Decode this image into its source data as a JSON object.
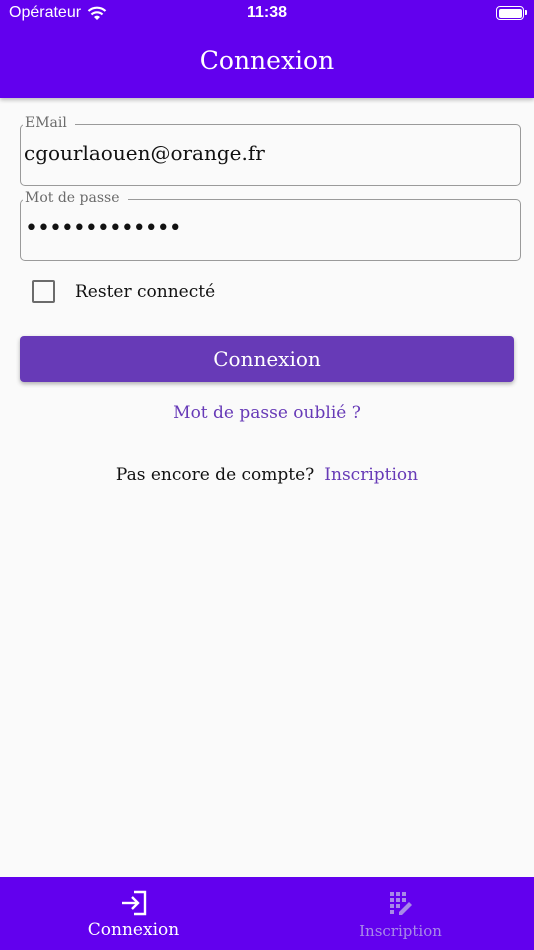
{
  "status_bar": {
    "carrier": "Opérateur",
    "time": "11:38"
  },
  "app_bar": {
    "title": "Connexion"
  },
  "form": {
    "email": {
      "label": "EMail",
      "value": "cgourlaouen@orange.fr"
    },
    "password": {
      "label": "Mot de passe",
      "value_masked": "•••••••••••••"
    },
    "remember": {
      "label": "Rester connecté",
      "checked": false
    },
    "submit_label": "Connexion",
    "forgot_label": "Mot de passe oublié ?",
    "signup_prompt": "Pas encore de compte?",
    "signup_link": "Inscription"
  },
  "bottom_nav": {
    "items": [
      {
        "label": "Connexion",
        "icon": "login-icon",
        "active": true
      },
      {
        "label": "Inscription",
        "icon": "register-icon",
        "active": false
      }
    ]
  },
  "colors": {
    "primary": "#6200ee",
    "accent": "#673ab7",
    "background": "#fafafa"
  }
}
